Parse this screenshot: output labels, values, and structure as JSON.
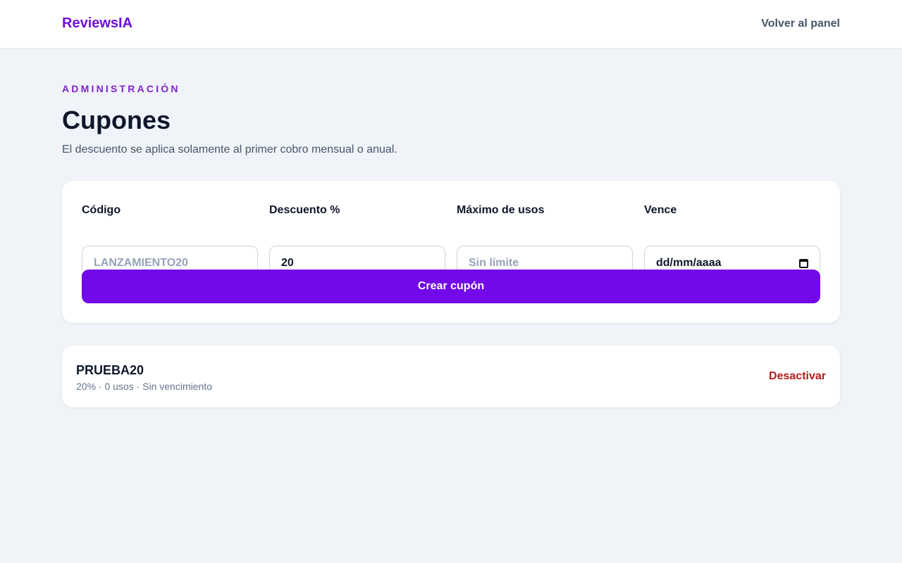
{
  "header": {
    "brand": "ReviewsIA",
    "back_link": "Volver al panel"
  },
  "page": {
    "eyebrow": "ADMINISTRACIÓN",
    "title": "Cupones",
    "subtitle": "El descuento se aplica solamente al primer cobro mensual o anual."
  },
  "form": {
    "fields": [
      {
        "label": "Código",
        "value": "",
        "placeholder": "LANZAMIENTO20"
      },
      {
        "label": "Descuento %",
        "value": "20",
        "placeholder": ""
      },
      {
        "label": "Máximo de usos",
        "value": "",
        "placeholder": "Sin límite"
      },
      {
        "label": "Vence",
        "value": "dd/mm/aaaa",
        "placeholder": "",
        "icon": "calendar-icon"
      }
    ],
    "submit_label": "Crear cupón"
  },
  "coupons": [
    {
      "code": "PRUEBA20",
      "meta": "20% · 0 usos · Sin vencimiento",
      "action": "Desactivar"
    }
  ],
  "colors": {
    "brand": "#6d0fe0",
    "accent_button": "#7209e9",
    "danger": "#b91c1c",
    "background": "#f0f3f8"
  }
}
